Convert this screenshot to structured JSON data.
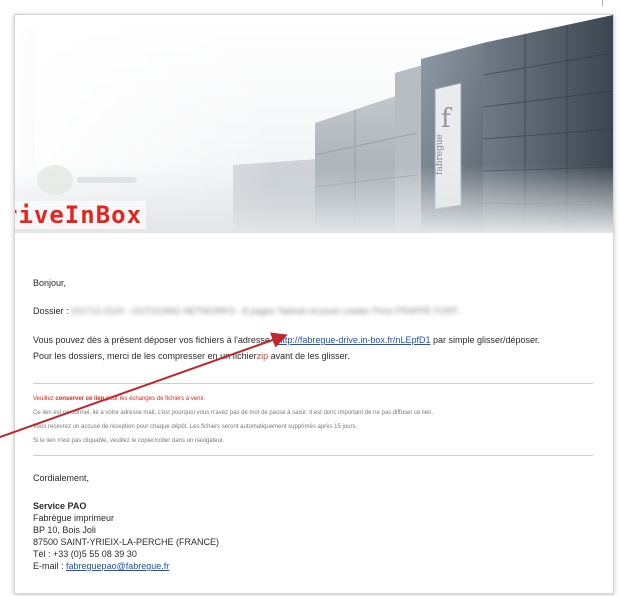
{
  "hero": {
    "brand_text": "riveInBox",
    "building_sign": "fabrègue"
  },
  "greeting": "Bonjour,",
  "dossier": {
    "label": "Dossier :",
    "number_blurred": "201712.0124 -",
    "client_blurred": "OUTGOING NETWORKS",
    "description": ": 8 pages Tabloid recassé Leader Price FRAPPE FORT."
  },
  "deposit": {
    "line1_prefix": "Vous pouvez dès à présent déposer vos fichiers à l'adresse :",
    "url": "http://fabregue-drive.in-box.fr/nLEpfD1",
    "line1_suffix": "par simple glisser/déposer.",
    "line2_prefix": "Pour les dossiers, merci de les compresser en un fichier",
    "line2_hidden": "zip",
    "line2_suffix": "avant de les glisser."
  },
  "notice": {
    "line1_a": "Veuillez",
    "line1_b": "conserver ce lien",
    "line1_c": "pour les échanges de fichiers à venir.",
    "line2": "Ce lien est personnel, lié à votre adresse mail, c'est pourquoi vous n'avez pas de mot de passe à saisir. Il est donc important de ne pas diffuser ce lien.",
    "line3": "Vous recevrez un accusé de réception pour chaque dépôt. Les fichiers seront automatiquement supprimés après 15 jours.",
    "line4": "Si le lien n'est pas cliquable, veuillez le copier/coller dans un navigateur."
  },
  "signature": {
    "closing": "Cordialement,",
    "team": "Service PAO",
    "company": "Fabrègue imprimeur",
    "address1": "BP 10, Bois Joli",
    "address2": "87500 SAINT-YRIEIX-LA-PERCHE (FRANCE)",
    "phone": "Tél : +33 (0)5 55 08 39 30",
    "email_label": "E-mail :",
    "email": "fabreguepao@fabregue.fr"
  },
  "colors": {
    "accent": "#e8231f",
    "link": "#1a55b8",
    "warning": "#d8281f"
  }
}
